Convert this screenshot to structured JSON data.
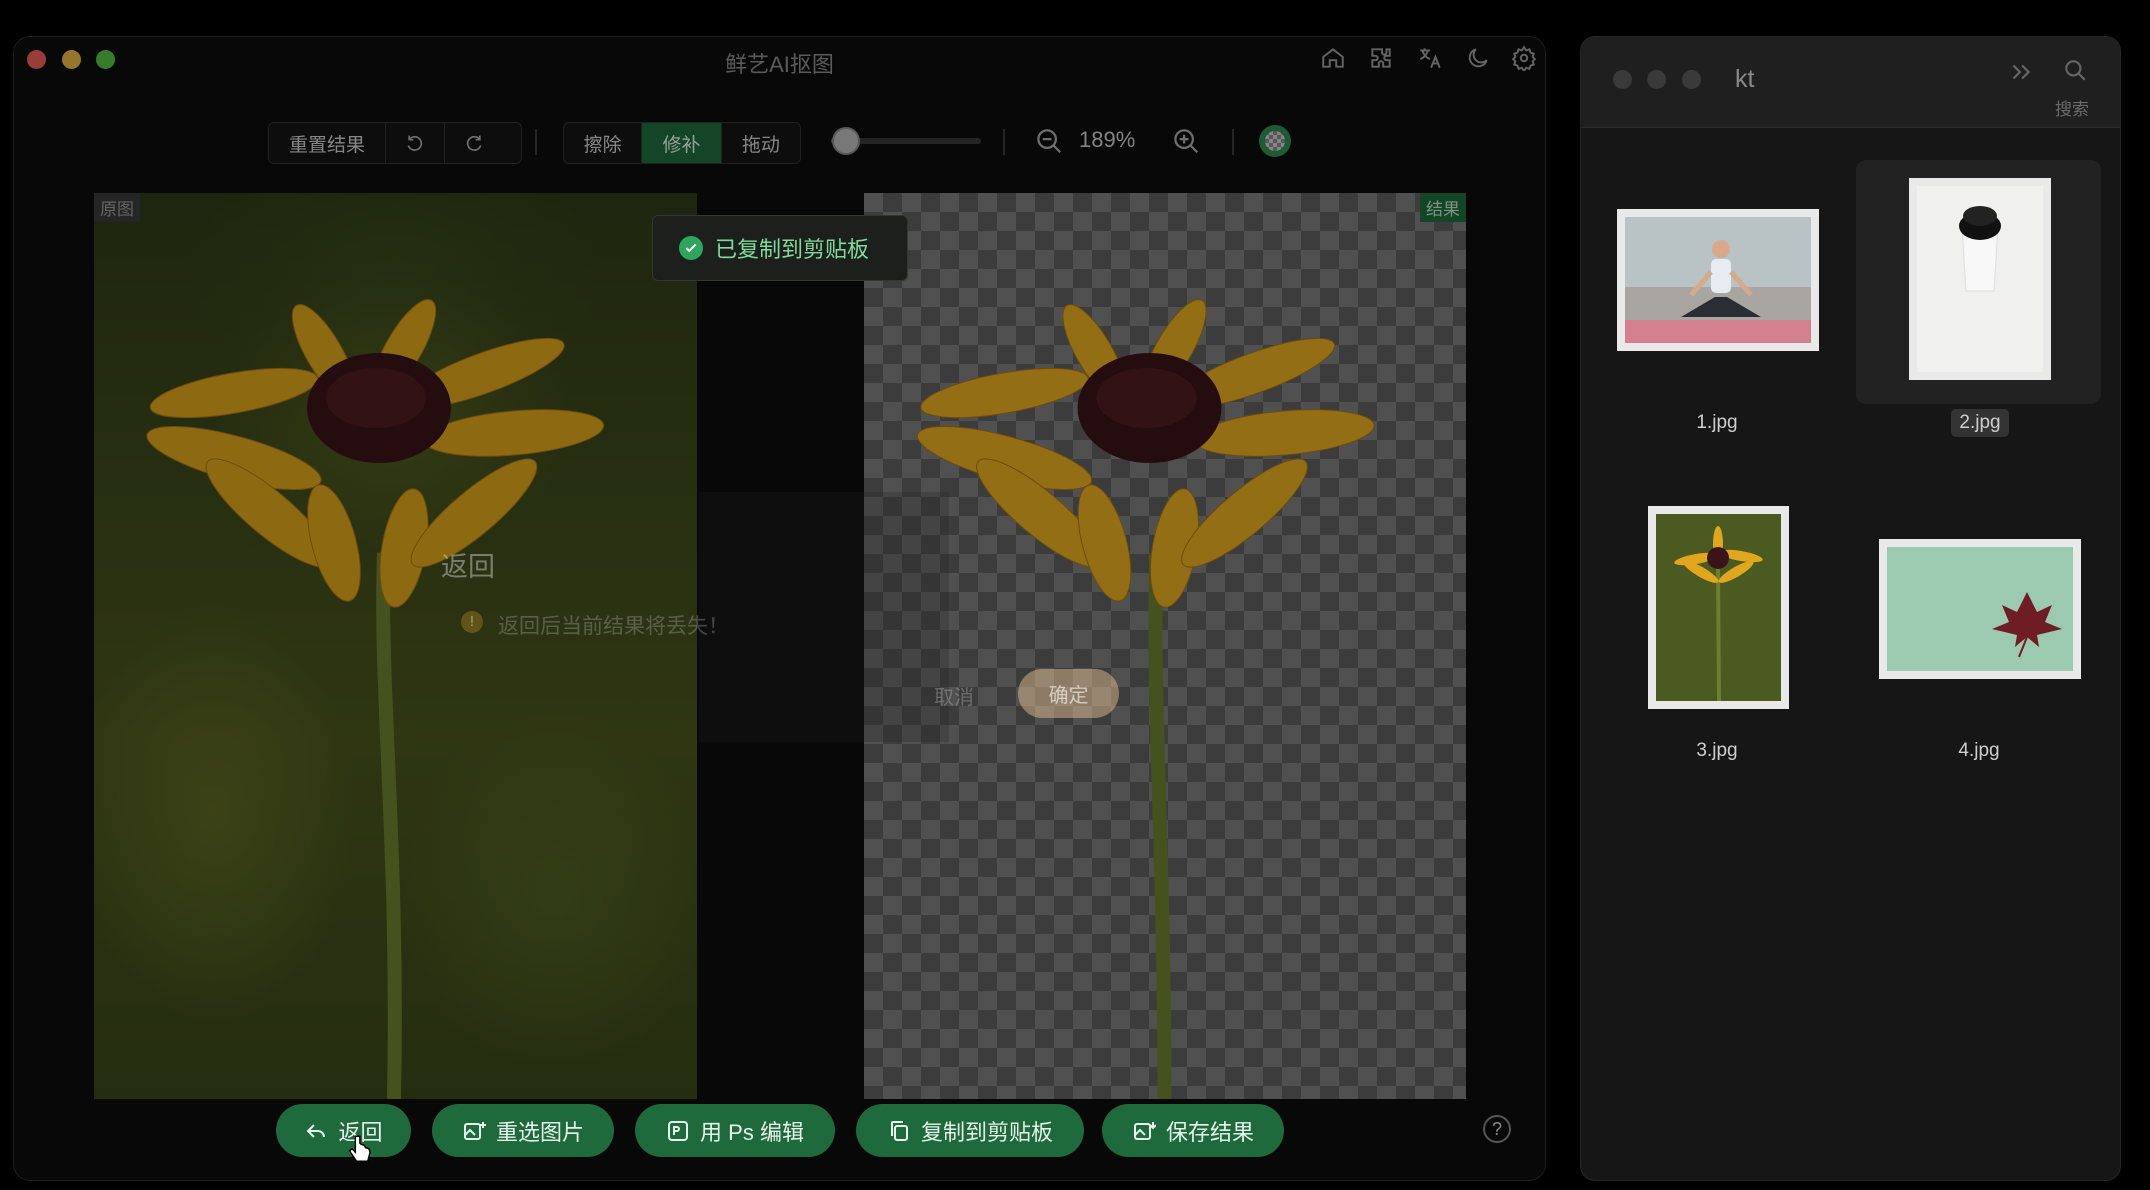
{
  "app": {
    "title": "鲜艺AI抠图"
  },
  "toolbar": {
    "reset_label": "重置结果",
    "undo_icon": "undo-icon",
    "redo_icon": "redo-icon",
    "modes": [
      "擦除",
      "修补",
      "拖动"
    ],
    "active_mode": "修补",
    "brush_size": 0.1,
    "zoom": "189%"
  },
  "panes": {
    "original_tag": "原图",
    "result_tag": "结果"
  },
  "toast": {
    "message": "已复制到剪贴板"
  },
  "dialog": {
    "title": "返回",
    "message": "返回后当前结果将丢失！",
    "cancel_label": "取消",
    "confirm_label": "确定"
  },
  "bottom_bar": {
    "back_label": "返回",
    "reselect_label": "重选图片",
    "ps_label": "用 Ps 编辑",
    "copy_label": "复制到剪贴板",
    "save_label": "保存结果"
  },
  "file_browser": {
    "folder": "kt",
    "search_label": "搜索",
    "files": [
      "1.jpg",
      "2.jpg",
      "3.jpg",
      "4.jpg"
    ],
    "selected": "2.jpg"
  },
  "colors": {
    "accent": "#1f6a3c",
    "toast_text": "#7fdc9a",
    "background": "#0d0d0d"
  }
}
